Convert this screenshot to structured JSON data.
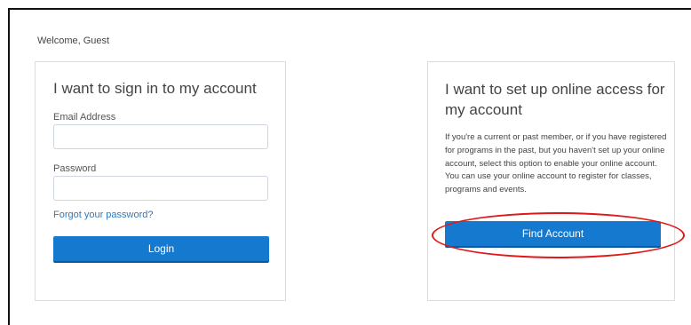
{
  "welcome": "Welcome, Guest",
  "sign_in": {
    "title": "I want to sign in to my account",
    "email_label": "Email Address",
    "email_value": "",
    "password_label": "Password",
    "password_value": "",
    "forgot_link": "Forgot your password?",
    "login_button": "Login"
  },
  "setup": {
    "title": "I want to set up online access for my account",
    "description": "If you're a current or past member, or if you have registered for programs in the past, but you haven't set up your online account, select this option to enable your online account. You can use your online account to register for classes, programs and events.",
    "find_button": "Find Account"
  },
  "colors": {
    "primary_button": "#1479cf",
    "link": "#2f79bd",
    "annotation_circle": "#e01818"
  }
}
